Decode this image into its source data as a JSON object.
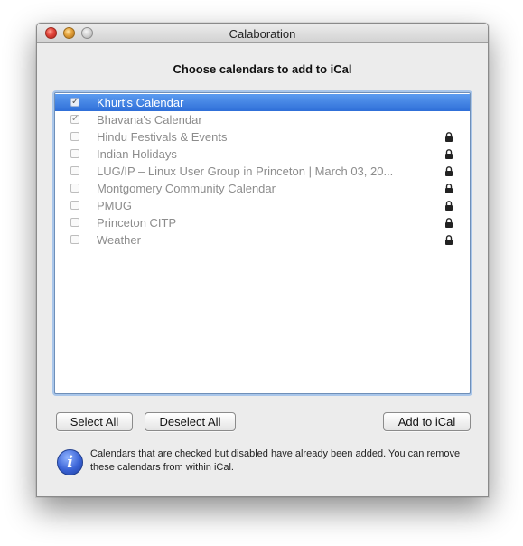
{
  "window": {
    "title": "Calaboration"
  },
  "dialog": {
    "heading": "Choose calendars to add to iCal"
  },
  "calendars": [
    {
      "label": "Khürt's Calendar",
      "checked": true,
      "locked": false,
      "selected": true
    },
    {
      "label": "Bhavana's Calendar",
      "checked": true,
      "locked": false,
      "selected": false
    },
    {
      "label": "Hindu Festivals & Events",
      "checked": false,
      "locked": true,
      "selected": false
    },
    {
      "label": "Indian Holidays",
      "checked": false,
      "locked": true,
      "selected": false
    },
    {
      "label": "LUG/IP – Linux User Group in Princeton | March 03, 20...",
      "checked": false,
      "locked": true,
      "selected": false
    },
    {
      "label": "Montgomery Community Calendar",
      "checked": false,
      "locked": true,
      "selected": false
    },
    {
      "label": "PMUG",
      "checked": false,
      "locked": true,
      "selected": false
    },
    {
      "label": "Princeton CITP",
      "checked": false,
      "locked": true,
      "selected": false
    },
    {
      "label": "Weather",
      "checked": false,
      "locked": true,
      "selected": false
    }
  ],
  "buttons": {
    "select_all": "Select All",
    "deselect_all": "Deselect All",
    "add_to_ical": "Add to iCal"
  },
  "info": {
    "icon": "info-icon",
    "text": "Calendars that are checked but disabled have already been added. You can remove these calendars from within iCal."
  },
  "colors": {
    "selection": "#3d7fe3",
    "focus_ring": "#a9c6ea",
    "info_icon": "#3a63d6"
  }
}
